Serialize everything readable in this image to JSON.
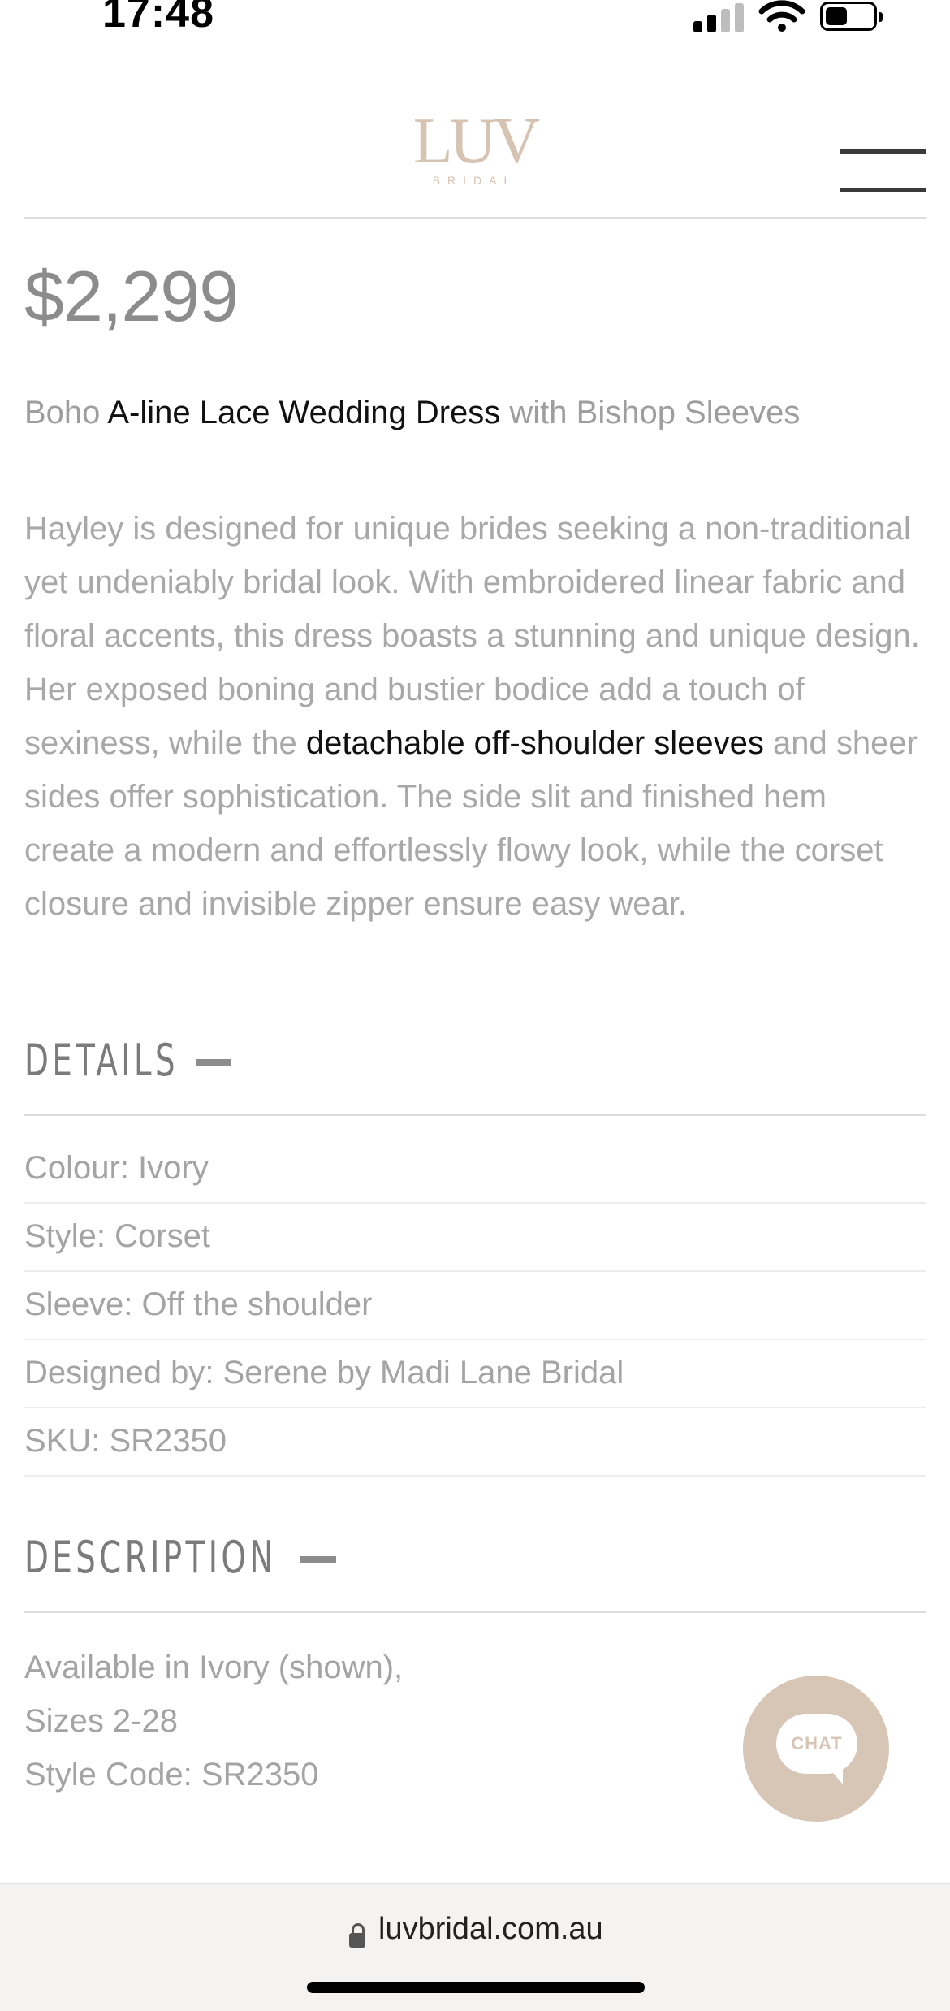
{
  "status_bar": {
    "time": "17:48",
    "battery_level": 0.45
  },
  "header": {
    "logo_main": "LUV",
    "logo_sub": "BRIDAL",
    "menu_icon": "hamburger-menu-icon"
  },
  "product": {
    "price": "$2,299",
    "title_prefix": "Boho ",
    "title_link": "A-line Lace Wedding Dress",
    "title_suffix": " with Bishop Sleeves",
    "description_part1": "Hayley is designed for unique brides seeking a non-traditional yet undeniably bridal look. With embroidered linear fabric and floral accents, this dress boasts a stunning and unique design. Her exposed boning and bustier bodice add a touch of sexiness, while the ",
    "description_link": "detachable off-shoulder sleeves",
    "description_part2": " and sheer sides offer sophistication. The side slit and finished hem create a modern and effortlessly flowy look, while the corset closure and invisible zipper ensure easy wear."
  },
  "details": {
    "heading": "DETAILS",
    "rows": [
      "Colour: Ivory",
      "Style: Corset",
      "Sleeve: Off the shoulder",
      "Designed by: Serene by Madi Lane Bridal",
      "SKU: SR2350"
    ]
  },
  "description_section": {
    "heading": "DESCRIPTION",
    "lines": [
      "Available in Ivory (shown),",
      "Sizes 2-28",
      "Style Code: SR2350"
    ]
  },
  "chat": {
    "label": "CHAT"
  },
  "browser": {
    "url": "luvbridal.com.au"
  },
  "colors": {
    "brand": "#d7c5b6",
    "text_muted": "#a4a4a4",
    "text_link": "#111111"
  }
}
